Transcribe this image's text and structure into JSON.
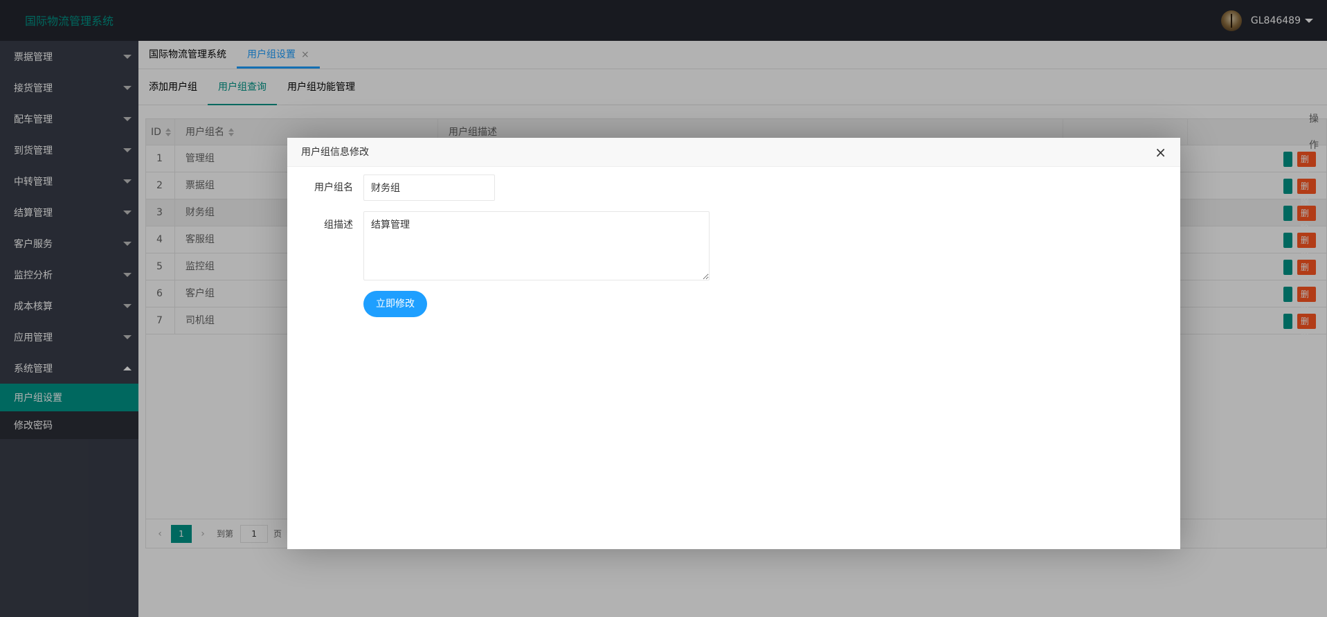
{
  "header": {
    "title": "国际物流管理系统",
    "username": "GL846489"
  },
  "sidebar": {
    "items": [
      {
        "label": "票据管理"
      },
      {
        "label": "接货管理"
      },
      {
        "label": "配车管理"
      },
      {
        "label": "到货管理"
      },
      {
        "label": "中转管理"
      },
      {
        "label": "结算管理"
      },
      {
        "label": "客户服务"
      },
      {
        "label": "监控分析"
      },
      {
        "label": "成本核算"
      },
      {
        "label": "应用管理"
      },
      {
        "label": "系统管理"
      }
    ],
    "subitems": [
      {
        "label": "用户组设置"
      },
      {
        "label": "修改密码"
      }
    ]
  },
  "top_tabs": [
    {
      "label": "国际物流管理系统"
    },
    {
      "label": "用户组设置",
      "close": "×"
    }
  ],
  "inner_tabs": [
    {
      "label": "添加用户组"
    },
    {
      "label": "用户组查询"
    },
    {
      "label": "用户组功能管理"
    }
  ],
  "table": {
    "headers": {
      "id": "ID",
      "name": "用户组名",
      "desc": "用户组描述",
      "op": "操作"
    },
    "rows": [
      {
        "id": "1",
        "name": "管理组"
      },
      {
        "id": "2",
        "name": "票据组"
      },
      {
        "id": "3",
        "name": "财务组"
      },
      {
        "id": "4",
        "name": "客服组"
      },
      {
        "id": "5",
        "name": "监控组"
      },
      {
        "id": "6",
        "name": "客户组"
      },
      {
        "id": "7",
        "name": "司机组"
      }
    ],
    "delete_label": "删除"
  },
  "pager": {
    "prev": "‹",
    "current": "1",
    "next": "›",
    "goto_label": "到第",
    "goto_value": "1",
    "page_suffix": "页"
  },
  "modal": {
    "title": "用户组信息修改",
    "close": "×",
    "name_label": "用户组名",
    "name_value": "财务组",
    "desc_label": "组描述",
    "desc_value": "结算管理",
    "submit_label": "立即修改"
  },
  "colors": {
    "header_bg": "#23262e",
    "sidebar_bg": "#393d49",
    "accent": "#009688",
    "blue": "#1e9fff",
    "danger": "#ff5722"
  }
}
